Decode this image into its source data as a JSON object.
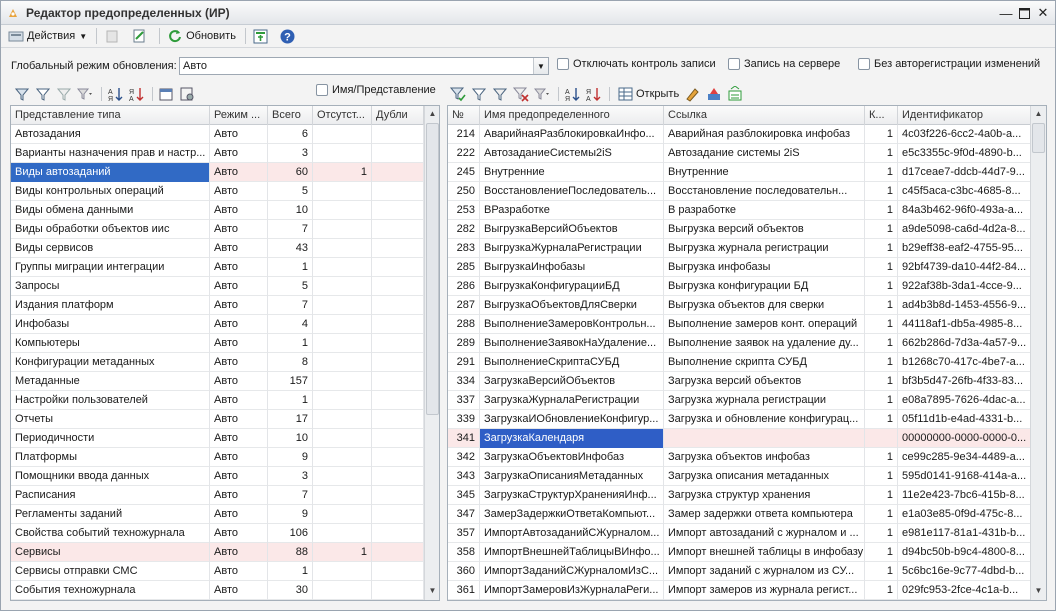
{
  "window": {
    "title": "Редактор предопределенных (ИР)"
  },
  "toolbar": {
    "actions_label": "Действия",
    "refresh_label": "Обновить"
  },
  "filter": {
    "mode_label": "Глобальный режим обновления:",
    "mode_value": "Авто",
    "disable_control_label": "Отключать контроль записи",
    "server_write_label": "Запись на сервере",
    "no_autoreg_label": "Без авторегистрации изменений",
    "name_repr_label": "Имя/Представление"
  },
  "right_toolbar": {
    "open_label": "Открыть"
  },
  "left_table": {
    "headers": [
      "Представление типа",
      "Режим ...",
      "Всего",
      "Отсутст...",
      "Дубли"
    ],
    "rows": [
      [
        "Автозадания",
        "Авто",
        "6",
        "",
        ""
      ],
      [
        "Варианты назначения прав и настр...",
        "Авто",
        "3",
        "",
        ""
      ],
      [
        "Виды автозаданий",
        "Авто",
        "60",
        "1",
        ""
      ],
      [
        "Виды контрольных операций",
        "Авто",
        "5",
        "",
        ""
      ],
      [
        "Виды обмена данными",
        "Авто",
        "10",
        "",
        ""
      ],
      [
        "Виды обработки объектов иис",
        "Авто",
        "7",
        "",
        ""
      ],
      [
        "Виды сервисов",
        "Авто",
        "43",
        "",
        ""
      ],
      [
        "Группы миграции интеграции",
        "Авто",
        "1",
        "",
        ""
      ],
      [
        "Запросы",
        "Авто",
        "5",
        "",
        ""
      ],
      [
        "Издания платформ",
        "Авто",
        "7",
        "",
        ""
      ],
      [
        "Инфобазы",
        "Авто",
        "4",
        "",
        ""
      ],
      [
        "Компьютеры",
        "Авто",
        "1",
        "",
        ""
      ],
      [
        "Конфигурации метаданных",
        "Авто",
        "8",
        "",
        ""
      ],
      [
        "Метаданные",
        "Авто",
        "157",
        "",
        ""
      ],
      [
        "Настройки пользователей",
        "Авто",
        "1",
        "",
        ""
      ],
      [
        "Отчеты",
        "Авто",
        "17",
        "",
        ""
      ],
      [
        "Периодичности",
        "Авто",
        "10",
        "",
        ""
      ],
      [
        "Платформы",
        "Авто",
        "9",
        "",
        ""
      ],
      [
        "Помощники ввода данных",
        "Авто",
        "3",
        "",
        ""
      ],
      [
        "Расписания",
        "Авто",
        "7",
        "",
        ""
      ],
      [
        "Регламенты заданий",
        "Авто",
        "9",
        "",
        ""
      ],
      [
        "Свойства событий техножурнала",
        "Авто",
        "106",
        "",
        ""
      ],
      [
        "Сервисы",
        "Авто",
        "88",
        "1",
        ""
      ],
      [
        "Сервисы отправки СМС",
        "Авто",
        "1",
        "",
        ""
      ],
      [
        "События техножурнала",
        "Авто",
        "30",
        "",
        ""
      ]
    ]
  },
  "right_table": {
    "headers": [
      "№",
      "Имя предопределенного",
      "Ссылка",
      "К...",
      "Идентификатор"
    ],
    "rows": [
      [
        "214",
        "АварийнаяРазблокировкаИнфо...",
        "Аварийная разблокировка инфобаз",
        "1",
        "4c03f226-6cc2-4a0b-a..."
      ],
      [
        "222",
        "АвтозаданиеСистемы2iS",
        "Автозадание системы 2iS",
        "1",
        "e5c3355c-9f0d-4890-b..."
      ],
      [
        "245",
        "Внутренние",
        "Внутренние",
        "1",
        "d17ceae7-ddcb-44d7-9..."
      ],
      [
        "250",
        "ВосстановлениеПоследователь...",
        "Восстановление последовательн...",
        "1",
        "c45f5aca-c3bc-4685-8..."
      ],
      [
        "253",
        "ВРазработке",
        "В разработке",
        "1",
        "84a3b462-96f0-493a-a..."
      ],
      [
        "282",
        "ВыгрузкаВерсийОбъектов",
        "Выгрузка версий объектов",
        "1",
        "a9de5098-ca6d-4d2a-8..."
      ],
      [
        "283",
        "ВыгрузкаЖурналаРегистрации",
        "Выгрузка журнала регистрации",
        "1",
        "b29eff38-eaf2-4755-95..."
      ],
      [
        "285",
        "ВыгрузкаИнфобазы",
        "Выгрузка инфобазы",
        "1",
        "92bf4739-da10-44f2-84..."
      ],
      [
        "286",
        "ВыгрузкаКонфигурацииБД",
        "Выгрузка конфигурации БД",
        "1",
        "922af38b-3da1-4cce-9..."
      ],
      [
        "287",
        "ВыгрузкаОбъектовДляСверки",
        "Выгрузка объектов для сверки",
        "1",
        "ad4b3b8d-1453-4556-9..."
      ],
      [
        "288",
        "ВыполнениеЗамеровКонтрольн...",
        "Выполнение замеров конт. операций",
        "1",
        "44118af1-db5a-4985-8..."
      ],
      [
        "289",
        "ВыполнениеЗаявокНаУдаление...",
        "Выполнение заявок на удаление ду...",
        "1",
        "662b286d-7d3a-4a57-9..."
      ],
      [
        "291",
        "ВыполнениеСкриптаСУБД",
        "Выполнение скрипта СУБД",
        "1",
        "b1268c70-417c-4be7-a..."
      ],
      [
        "334",
        "ЗагрузкаВерсийОбъектов",
        "Загрузка версий объектов",
        "1",
        "bf3b5d47-26fb-4f33-83..."
      ],
      [
        "337",
        "ЗагрузкаЖурналаРегистрации",
        "Загрузка журнала регистрации",
        "1",
        "e08a7895-7626-4dac-a..."
      ],
      [
        "339",
        "ЗагрузкаИОбновлениеКонфигур...",
        "Загрузка и обновление конфигурац...",
        "1",
        "05f11d1b-e4ad-4331-b..."
      ],
      [
        "341",
        "ЗагрузкаКалендаря",
        "",
        "",
        "00000000-0000-0000-0..."
      ],
      [
        "342",
        "ЗагрузкаОбъектовИнфобаз",
        "Загрузка объектов инфобаз",
        "1",
        "ce99c285-9e34-4489-a..."
      ],
      [
        "343",
        "ЗагрузкаОписанияМетаданных",
        "Загрузка описания метаданных",
        "1",
        "595d0141-9168-414a-a..."
      ],
      [
        "345",
        "ЗагрузкаСтруктурХраненияИнф...",
        "Загрузка структур хранения",
        "1",
        "11e2e423-7bc6-415b-8..."
      ],
      [
        "347",
        "ЗамерЗадержкиОтветаКомпьют...",
        "Замер задержки ответа компьютера",
        "1",
        "e1a03e85-0f9d-475c-8..."
      ],
      [
        "357",
        "ИмпортАвтозаданийСЖурналом...",
        "Импорт автозаданий с журналом и ...",
        "1",
        "e981e117-81a1-431b-b..."
      ],
      [
        "358",
        "ИмпортВнешнейТаблицыВИнфо...",
        "Импорт внешней таблицы в инфобазу",
        "1",
        "d94bc50b-b9c4-4800-8..."
      ],
      [
        "360",
        "ИмпортЗаданийСЖурналомИзС...",
        "Импорт заданий с журналом из СУ...",
        "1",
        "5c6bc16e-9c77-4dbd-b..."
      ],
      [
        "361",
        "ИмпортЗамеровИзЖурналаРеги...",
        "Импорт замеров из журнала регист...",
        "1",
        "029fc953-2fce-4c1a-b..."
      ]
    ]
  }
}
